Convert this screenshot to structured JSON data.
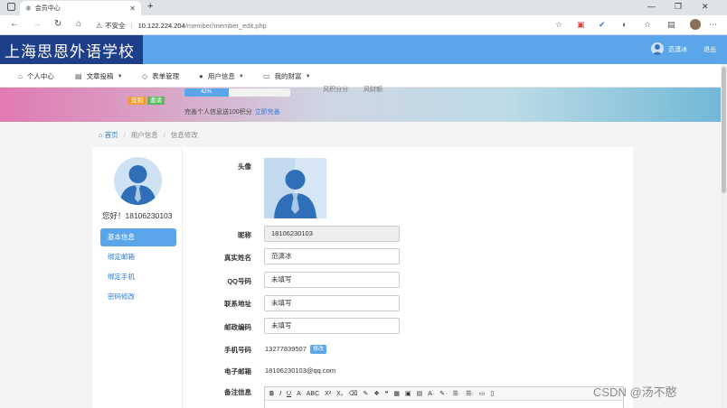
{
  "browser": {
    "tab_title": "会员中心",
    "security_label": "不安全",
    "url_host": "10.122.224.204",
    "url_path": "/member/member_edit.php"
  },
  "site": {
    "logo_text": "上海思恩外语学校",
    "user_name": "范潇冰",
    "logout": "退出"
  },
  "menu": [
    {
      "label": "个人中心",
      "icon": "home-icon",
      "dropdown": false
    },
    {
      "label": "文章投稿",
      "icon": "document-icon",
      "dropdown": true
    },
    {
      "label": "表单管理",
      "icon": "diamond-icon",
      "dropdown": false
    },
    {
      "label": "用户信息",
      "icon": "user-icon",
      "dropdown": true
    },
    {
      "label": "我的财富",
      "icon": "card-icon",
      "dropdown": true
    }
  ],
  "banner": {
    "signin_label": "签到",
    "invite_label": "邀请",
    "progress_text": "42%",
    "progress_value": 0.42,
    "tip_text": "完善个人信息送100积分",
    "tip_link": "立即完善",
    "partial_left": "风积分分",
    "partial_right": "风财额"
  },
  "breadcrumb": {
    "home": "首页",
    "section": "用户信息",
    "current": "信息修改"
  },
  "sidebar": {
    "greeting": "您好！18106230103",
    "items": [
      {
        "label": "基本信息",
        "active": true
      },
      {
        "label": "绑定邮箱",
        "active": false
      },
      {
        "label": "绑定手机",
        "active": false
      },
      {
        "label": "密码修改",
        "active": false
      }
    ]
  },
  "form": {
    "avatar_label": "头像",
    "nickname_label": "昵称",
    "nickname_value": "18106230103",
    "realname_label": "真实姓名",
    "realname_value": "范潇冰",
    "qq_label": "QQ号码",
    "qq_value": "未填写",
    "address_label": "联系地址",
    "address_value": "未填写",
    "zip_label": "邮政编码",
    "zip_value": "未填写",
    "phone_label": "手机号码",
    "phone_value": "13277839507",
    "phone_edit": "修改",
    "email_label": "电子邮箱",
    "email_value": "18106230103@qq.com",
    "remark_label": "备注信息"
  },
  "editor_toolbar": [
    "B",
    "I",
    "U",
    "A",
    "ABC",
    "X²",
    "X₂",
    "⌫",
    "✎",
    "❖",
    "❝",
    "▦",
    "▣",
    "▤",
    "A·",
    "✎·",
    "☰·",
    "☰·",
    "▭",
    "▯"
  ],
  "watermark": "CSDN @汤不憨",
  "colors": {
    "accent": "#5aa6e8",
    "logo_bg": "#1d3f8a",
    "link": "#2a7bd8",
    "signin": "#f0a030",
    "invite": "#5cb85c"
  }
}
